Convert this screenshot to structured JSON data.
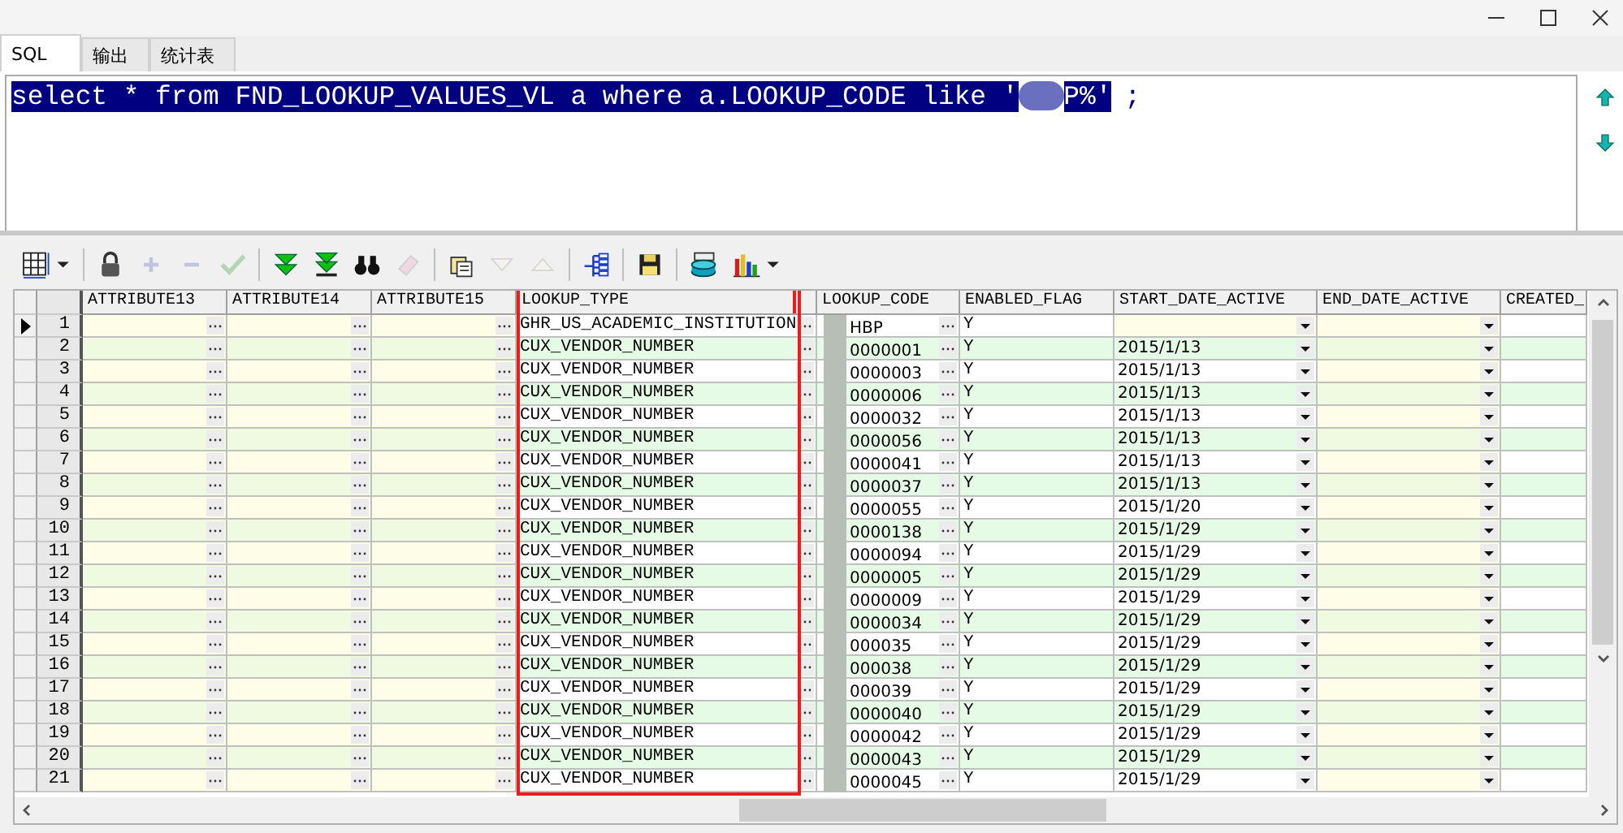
{
  "window": {
    "controls": [
      {
        "kind": "minimize"
      },
      {
        "kind": "maximize"
      },
      {
        "kind": "close"
      }
    ]
  },
  "tabs": [
    {
      "label": "SQL",
      "selected": true
    },
    {
      "label": "输出",
      "selected": false
    },
    {
      "label": "统计表",
      "selected": false
    }
  ],
  "editor": {
    "selected_text": "select * from FND_LOOKUP_VALUES_VL a where a.LOOKUP_CODE like '",
    "selected_text_after_redaction": "P%'",
    "trailing_text": ";"
  },
  "toolbar": [
    {
      "kind": "grid",
      "disabled": false
    },
    {
      "kind": "lock",
      "disabled": false
    },
    {
      "kind": "plus",
      "disabled": true
    },
    {
      "kind": "minus",
      "disabled": true
    },
    {
      "kind": "check",
      "disabled": true
    },
    {
      "kind": "fetch-next",
      "disabled": false
    },
    {
      "kind": "fetch-last",
      "disabled": false
    },
    {
      "kind": "find",
      "disabled": false
    },
    {
      "kind": "clear",
      "disabled": true
    },
    {
      "kind": "copy",
      "disabled": false
    },
    {
      "kind": "prev",
      "disabled": true
    },
    {
      "kind": "next",
      "disabled": true
    },
    {
      "kind": "tree",
      "disabled": false
    },
    {
      "kind": "save",
      "disabled": false
    },
    {
      "kind": "database",
      "disabled": false
    },
    {
      "kind": "chart",
      "disabled": false
    }
  ],
  "grid": {
    "columns": [
      {
        "label": "ATTRIBUTE13",
        "kind": "text",
        "highlighted": false
      },
      {
        "label": "ATTRIBUTE14",
        "kind": "text",
        "highlighted": false
      },
      {
        "label": "ATTRIBUTE15",
        "kind": "text",
        "highlighted": false
      },
      {
        "label": "LOOKUP_TYPE",
        "kind": "text",
        "highlighted": true
      },
      {
        "label": "LOOKUP_CODE",
        "kind": "redacted",
        "highlighted": false
      },
      {
        "label": "ENABLED_FLAG",
        "kind": "flag",
        "highlighted": false
      },
      {
        "label": "START_DATE_ACTIVE",
        "kind": "date",
        "highlighted": false
      },
      {
        "label": "END_DATE_ACTIVE",
        "kind": "date",
        "highlighted": false
      },
      {
        "label": "CREATED_",
        "kind": "cut",
        "highlighted": false
      }
    ],
    "rows": [
      {
        "number": "1",
        "current": true,
        "cells": [
          null,
          null,
          null,
          "GHR_US_ACADEMIC_INSTITUTION",
          "HBP",
          "Y",
          null,
          null,
          null
        ]
      },
      {
        "number": "2",
        "current": false,
        "cells": [
          null,
          null,
          null,
          "CUX_VENDOR_NUMBER",
          "0000001",
          "Y",
          "2015/1/13",
          null,
          null
        ]
      },
      {
        "number": "3",
        "current": false,
        "cells": [
          null,
          null,
          null,
          "CUX_VENDOR_NUMBER",
          "0000003",
          "Y",
          "2015/1/13",
          null,
          null
        ]
      },
      {
        "number": "4",
        "current": false,
        "cells": [
          null,
          null,
          null,
          "CUX_VENDOR_NUMBER",
          "0000006",
          "Y",
          "2015/1/13",
          null,
          null
        ]
      },
      {
        "number": "5",
        "current": false,
        "cells": [
          null,
          null,
          null,
          "CUX_VENDOR_NUMBER",
          "0000032",
          "Y",
          "2015/1/13",
          null,
          null
        ]
      },
      {
        "number": "6",
        "current": false,
        "cells": [
          null,
          null,
          null,
          "CUX_VENDOR_NUMBER",
          "0000056",
          "Y",
          "2015/1/13",
          null,
          null
        ]
      },
      {
        "number": "7",
        "current": false,
        "cells": [
          null,
          null,
          null,
          "CUX_VENDOR_NUMBER",
          "0000041",
          "Y",
          "2015/1/13",
          null,
          null
        ]
      },
      {
        "number": "8",
        "current": false,
        "cells": [
          null,
          null,
          null,
          "CUX_VENDOR_NUMBER",
          "0000037",
          "Y",
          "2015/1/13",
          null,
          null
        ]
      },
      {
        "number": "9",
        "current": false,
        "cells": [
          null,
          null,
          null,
          "CUX_VENDOR_NUMBER",
          "0000055",
          "Y",
          "2015/1/20",
          null,
          null
        ]
      },
      {
        "number": "10",
        "current": false,
        "cells": [
          null,
          null,
          null,
          "CUX_VENDOR_NUMBER",
          "0000138",
          "Y",
          "2015/1/29",
          null,
          null
        ]
      },
      {
        "number": "11",
        "current": false,
        "cells": [
          null,
          null,
          null,
          "CUX_VENDOR_NUMBER",
          "0000094",
          "Y",
          "2015/1/29",
          null,
          null
        ]
      },
      {
        "number": "12",
        "current": false,
        "cells": [
          null,
          null,
          null,
          "CUX_VENDOR_NUMBER",
          "0000005",
          "Y",
          "2015/1/29",
          null,
          null
        ]
      },
      {
        "number": "13",
        "current": false,
        "cells": [
          null,
          null,
          null,
          "CUX_VENDOR_NUMBER",
          "0000009",
          "Y",
          "2015/1/29",
          null,
          null
        ]
      },
      {
        "number": "14",
        "current": false,
        "cells": [
          null,
          null,
          null,
          "CUX_VENDOR_NUMBER",
          "0000034",
          "Y",
          "2015/1/29",
          null,
          null
        ]
      },
      {
        "number": "15",
        "current": false,
        "cells": [
          null,
          null,
          null,
          "CUX_VENDOR_NUMBER",
          "000035",
          "Y",
          "2015/1/29",
          null,
          null
        ]
      },
      {
        "number": "16",
        "current": false,
        "cells": [
          null,
          null,
          null,
          "CUX_VENDOR_NUMBER",
          "000038",
          "Y",
          "2015/1/29",
          null,
          null
        ]
      },
      {
        "number": "17",
        "current": false,
        "cells": [
          null,
          null,
          null,
          "CUX_VENDOR_NUMBER",
          "000039",
          "Y",
          "2015/1/29",
          null,
          null
        ]
      },
      {
        "number": "18",
        "current": false,
        "cells": [
          null,
          null,
          null,
          "CUX_VENDOR_NUMBER",
          "0000040",
          "Y",
          "2015/1/29",
          null,
          null
        ]
      },
      {
        "number": "19",
        "current": false,
        "cells": [
          null,
          null,
          null,
          "CUX_VENDOR_NUMBER",
          "0000042",
          "Y",
          "2015/1/29",
          null,
          null
        ]
      },
      {
        "number": "20",
        "current": false,
        "cells": [
          null,
          null,
          null,
          "CUX_VENDOR_NUMBER",
          "0000043",
          "Y",
          "2015/1/29",
          null,
          null
        ]
      },
      {
        "number": "21",
        "current": false,
        "cells": [
          null,
          null,
          null,
          "CUX_VENDOR_NUMBER",
          "0000045",
          "Y",
          "2015/1/29",
          null,
          null
        ]
      }
    ]
  }
}
